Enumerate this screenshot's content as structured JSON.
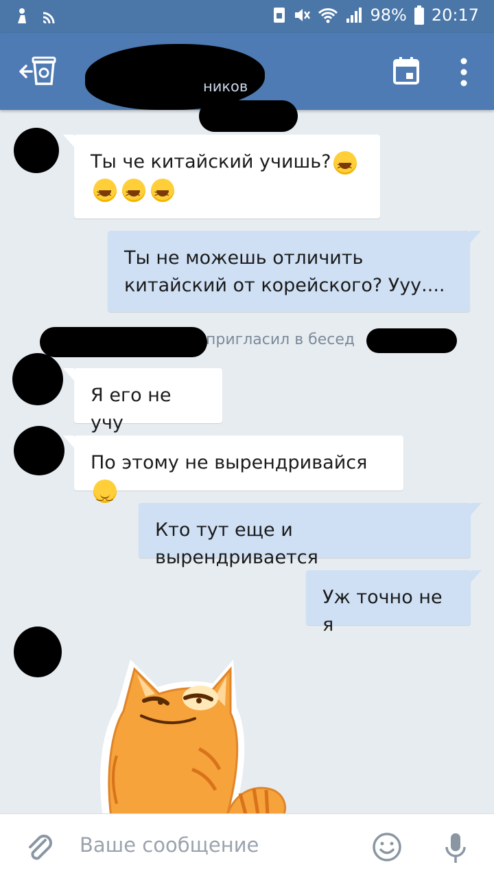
{
  "status_bar": {
    "battery": "98%",
    "time": "20:17"
  },
  "header": {
    "subtitle_fragment": "ников"
  },
  "messages": [
    {
      "direction": "in",
      "text": "Ты че китайский учишь?",
      "emoji": [
        "laughing",
        "laughing",
        "laughing",
        "laughing"
      ]
    },
    {
      "direction": "out",
      "line1": "Ты не можешь отличить",
      "line2": "китайский от корейского? Ууу...."
    },
    {
      "direction": "system",
      "text": "пригласил в бесед"
    },
    {
      "direction": "in",
      "text": "Я его не учу"
    },
    {
      "direction": "in",
      "text": "По этому не вырендривайся",
      "emoji": [
        "relieved"
      ]
    },
    {
      "direction": "out",
      "text": "Кто тут еще и вырендривается"
    },
    {
      "direction": "out",
      "text": "Уж точно не я"
    },
    {
      "direction": "in",
      "type": "sticker",
      "sticker": "orange-cat-smirk"
    }
  ],
  "input": {
    "placeholder": "Ваше сообщение"
  },
  "icons": {
    "back": "back-arrow-cup-icon",
    "calendar": "calendar-icon",
    "menu": "more-vertical-icon",
    "attach": "paperclip-icon",
    "emoji": "smile-icon",
    "mic": "microphone-icon"
  },
  "colors": {
    "header": "#4e7bb3",
    "background": "#e7ecf1",
    "outgoing_bubble": "#cfe0f5",
    "incoming_bubble": "#ffffff"
  }
}
